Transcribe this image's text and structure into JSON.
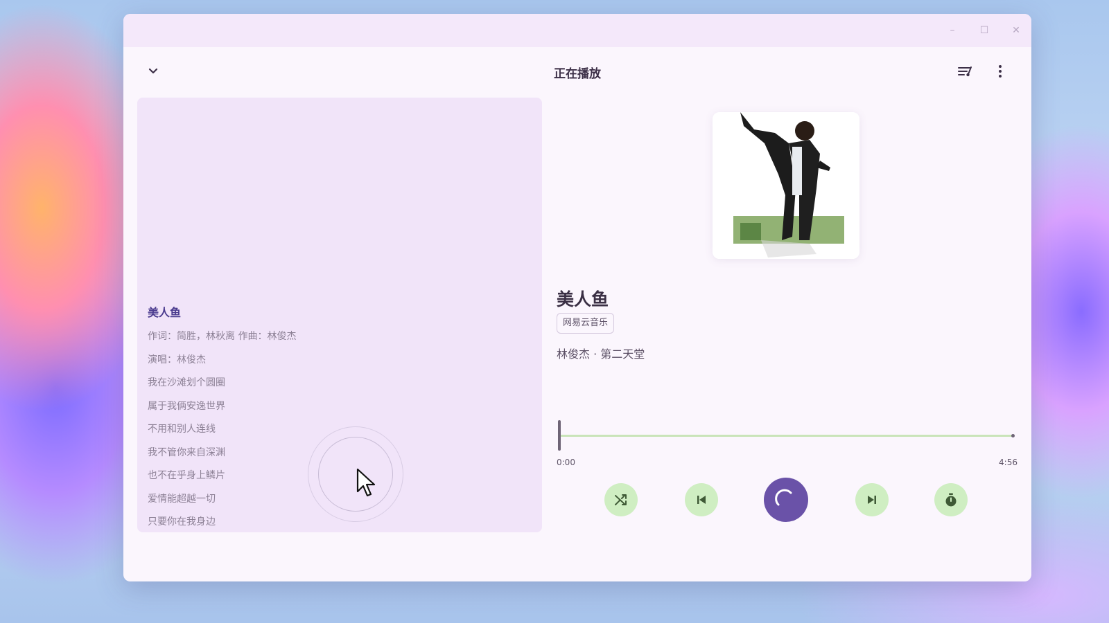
{
  "window": {
    "controls": {
      "minimize": "–",
      "maximize": "☐",
      "close": "✕"
    }
  },
  "appbar": {
    "title": "正在播放",
    "collapse_icon": "chevron-down-icon",
    "right_icons": [
      "playlist-icon",
      "more-vertical-icon"
    ]
  },
  "lyrics": {
    "title": "美人鱼",
    "lines": [
      "作词：简胜，林秋离 作曲：林俊杰",
      "演唱：林俊杰",
      "我在沙滩划个圆圈",
      "属于我俩安逸世界",
      "不用和别人连线",
      "我不管你来自深渊",
      "也不在乎身上鳞片",
      "爱情能超越一切",
      "只要你在我身边"
    ]
  },
  "track": {
    "title": "美人鱼",
    "source": "网易云音乐",
    "artist_album": "林俊杰 · 第二天堂"
  },
  "progress": {
    "current": "0:00",
    "total": "4:56",
    "fraction": 0.0
  },
  "controls": {
    "shuffle_icon": "shuffle-icon",
    "prev_icon": "skip-previous-icon",
    "play_state": "loading",
    "next_icon": "skip-next-icon",
    "timer_icon": "timer-icon"
  },
  "colors": {
    "accent": "#6a52a8",
    "control_bg": "#cfeec2",
    "lyrics_title": "#4a3a8e"
  }
}
